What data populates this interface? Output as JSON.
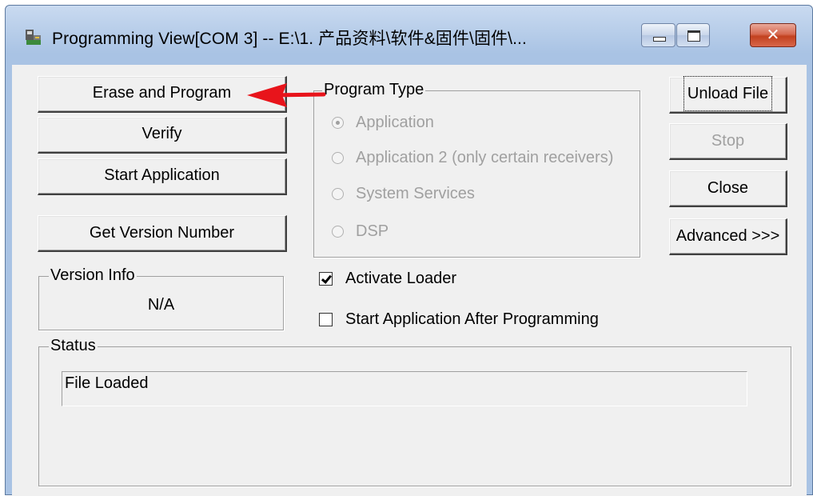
{
  "window": {
    "title": "Programming View[COM 3] -- E:\\1. 产品资料\\软件&固件\\固件\\...",
    "icon": "programmer-app-icon",
    "close_glyph": "✕"
  },
  "left_buttons": {
    "erase_program": "Erase and Program",
    "verify": "Verify",
    "start_application": "Start Application",
    "get_version": "Get Version Number"
  },
  "version_info": {
    "label": "Version Info",
    "value": "N/A"
  },
  "program_type": {
    "label": "Program Type",
    "options": [
      {
        "label": "Application",
        "selected": true,
        "enabled": false
      },
      {
        "label": "Application 2 (only certain receivers)",
        "selected": false,
        "enabled": false
      },
      {
        "label": "System Services",
        "selected": false,
        "enabled": false
      },
      {
        "label": "DSP",
        "selected": false,
        "enabled": false
      }
    ]
  },
  "options": {
    "activate_loader": {
      "label": "Activate Loader",
      "checked": true
    },
    "start_after_programming": {
      "label": "Start Application After Programming",
      "checked": false
    }
  },
  "right_buttons": {
    "unload_file": "Unload File",
    "stop": "Stop",
    "close": "Close",
    "advanced": "Advanced >>>"
  },
  "status": {
    "label": "Status",
    "text": "File Loaded"
  },
  "annotation": {
    "arrow_color": "#e8141b",
    "arrow_icon": "red-pointer-arrow-icon"
  },
  "colors": {
    "dialog_face": "#f0f0f0",
    "disabled_text": "#a0a0a0",
    "title_bar": "#a9c3e4"
  }
}
